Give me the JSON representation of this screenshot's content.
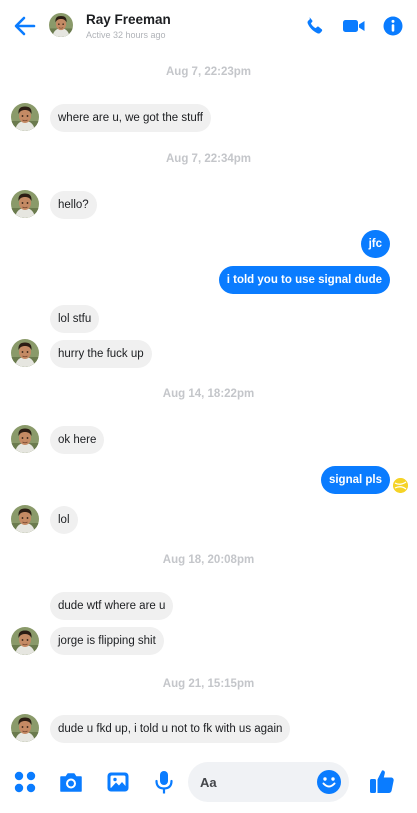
{
  "header": {
    "contact_name": "Ray Freeman",
    "status": "Active 32 hours ago",
    "icons": [
      "back-arrow-icon",
      "phone-icon",
      "video-camera-icon",
      "info-icon"
    ]
  },
  "messages": {
    "ts1": "Aug 7, 22:23pm",
    "m1": "where are u, we got the stuff",
    "ts2": "Aug 7, 22:34pm",
    "m2": "hello?",
    "m3": "jfc",
    "m4": "i told you to use signal dude",
    "m5": "lol stfu",
    "m6": "hurry the fuck up",
    "ts3": "Aug 14, 18:22pm",
    "m7": "ok here",
    "m8": "signal pls",
    "m9": "lol",
    "ts4": "Aug 18, 20:08pm",
    "m10": "dude wtf where are u",
    "m11": "jorge is flipping shit",
    "ts5": "Aug 21, 15:15pm",
    "m12": "dude u fkd up, i told u not to fk with us again"
  },
  "composer": {
    "placeholder": "Aa",
    "icons": [
      "apps-icon",
      "camera-icon",
      "image-icon",
      "microphone-icon",
      "emoji-icon",
      "thumbs-up-icon"
    ]
  },
  "colors": {
    "accent": "#0a7cff",
    "incoming_bubble": "#f0f0f0",
    "outgoing_bubble": "#0a7cff",
    "timestamp": "#c4c6ca"
  }
}
